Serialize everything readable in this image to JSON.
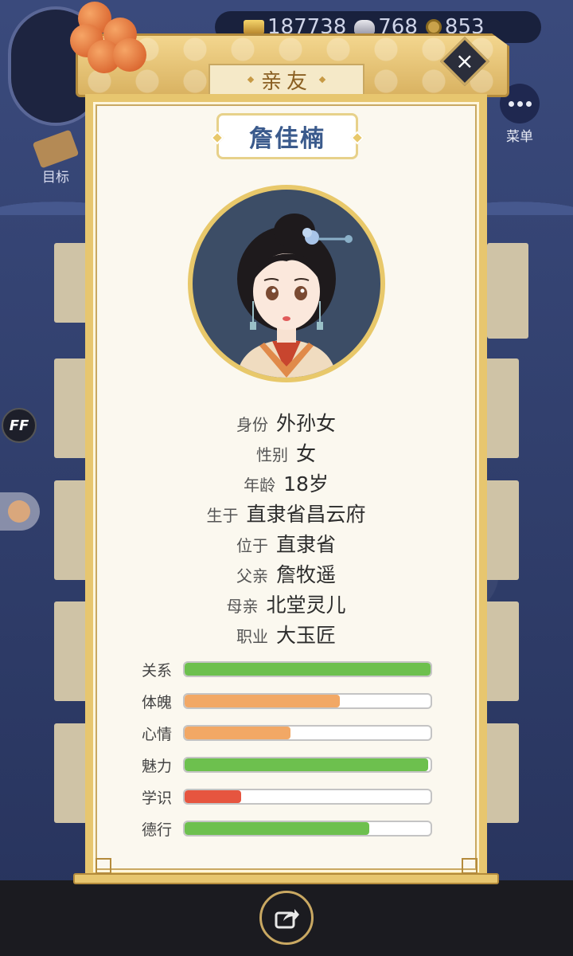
{
  "resources": {
    "gold": "187738",
    "silver": "768",
    "coin": "853"
  },
  "background": {
    "goal_label": "目标",
    "menu_label": "菜单",
    "ff_label": "FF"
  },
  "dialog": {
    "title": "亲友",
    "close_label": "×",
    "name": "詹佳楠",
    "info": [
      {
        "label": "身份",
        "value": "外孙女"
      },
      {
        "label": "性别",
        "value": "女"
      },
      {
        "label": "年龄",
        "value": "18岁"
      },
      {
        "label": "生于",
        "value": "直隶省昌云府"
      },
      {
        "label": "位于",
        "value": "直隶省"
      },
      {
        "label": "父亲",
        "value": "詹牧遥"
      },
      {
        "label": "母亲",
        "value": "北堂灵儿"
      },
      {
        "label": "职业",
        "value": "大玉匠"
      }
    ],
    "stats": [
      {
        "label": "关系",
        "value": 1.0,
        "color": "#6dc04e"
      },
      {
        "label": "体魄",
        "value": 0.63,
        "color": "#f2a865"
      },
      {
        "label": "心情",
        "value": 0.43,
        "color": "#f2a865"
      },
      {
        "label": "魅力",
        "value": 0.99,
        "color": "#6dc04e"
      },
      {
        "label": "学识",
        "value": 0.23,
        "color": "#e6553f"
      },
      {
        "label": "德行",
        "value": 0.75,
        "color": "#6dc04e"
      }
    ]
  }
}
